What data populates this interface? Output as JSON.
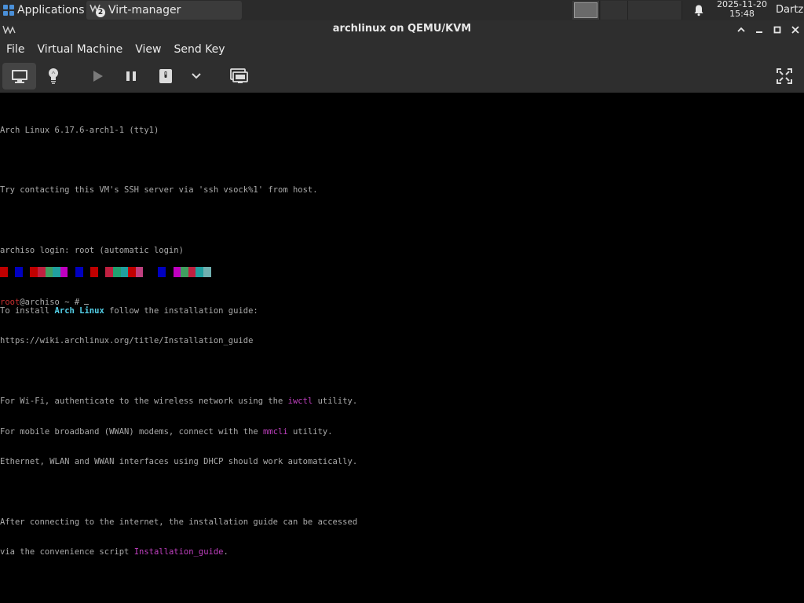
{
  "panel": {
    "applications_label": "Applications",
    "task_label": "Virt-manager",
    "task_badge": "2",
    "date": "2025-11-20",
    "time": "15:48",
    "user": "Dartz"
  },
  "window": {
    "title": "archlinux on QEMU/KVM"
  },
  "menu": {
    "items": [
      "File",
      "Virtual Machine",
      "View",
      "Send Key"
    ]
  },
  "toolbar": {
    "icons": [
      "console-icon",
      "lightbulb-icon",
      "play-icon",
      "pause-icon",
      "power-icon",
      "chevron-down-icon",
      "snapshot-icon",
      "fullscreen-icon"
    ]
  },
  "terminal": {
    "lines": [
      "Arch Linux 6.17.6-arch1-1 (tty1)",
      "",
      "Try contacting this VM's SSH server via 'ssh vsock%1' from host.",
      "",
      "archiso login: root (automatic login)",
      "",
      "To install ",
      "https://wiki.archlinux.org/title/Installation_guide",
      "",
      "For Wi-Fi, authenticate to the wireless network using the ",
      "For mobile broadband (WWAN) modems, connect with the ",
      "Ethernet, WLAN and WWAN interfaces using DHCP should work automatically.",
      "",
      "After connecting to the internet, the installation guide can be accessed",
      "via the convenience script "
    ],
    "install_highlight": "Arch Linux",
    "install_suffix": " follow the installation guide:",
    "iwctl": "iwctl",
    "iwctl_suffix": " utility.",
    "mmcli": "mmcli",
    "mmcli_suffix": " utility.",
    "guide_script": "Installation_guide",
    "guide_suffix": ".",
    "prompt_user": "root",
    "prompt_rest": "@archiso ~ #"
  },
  "colors": {
    "panel_bg": "#2b2b2b",
    "chrome_bg": "#2e2e2e",
    "terminal_fg": "#aaaaaa",
    "highlight_cyan": "#54d0e8",
    "highlight_magenta": "#c040c0",
    "prompt_red": "#cc3030"
  },
  "colorbar": [
    "#c00000",
    "#000000",
    "#0000c0",
    "#000000",
    "#c00000",
    "#c02040",
    "#40a060",
    "#20a0a0",
    "#c000c0",
    "#000000",
    "#0000c0",
    "#000000",
    "#c00000",
    "#000000",
    "#c02040",
    "#20a070",
    "#20a0a0",
    "#c00000",
    "#c04080",
    "#000000",
    "#000000",
    "#0000c0",
    "#000000",
    "#c000c0",
    "#40a060",
    "#c02040",
    "#20a0a0",
    "#70b0b0"
  ]
}
